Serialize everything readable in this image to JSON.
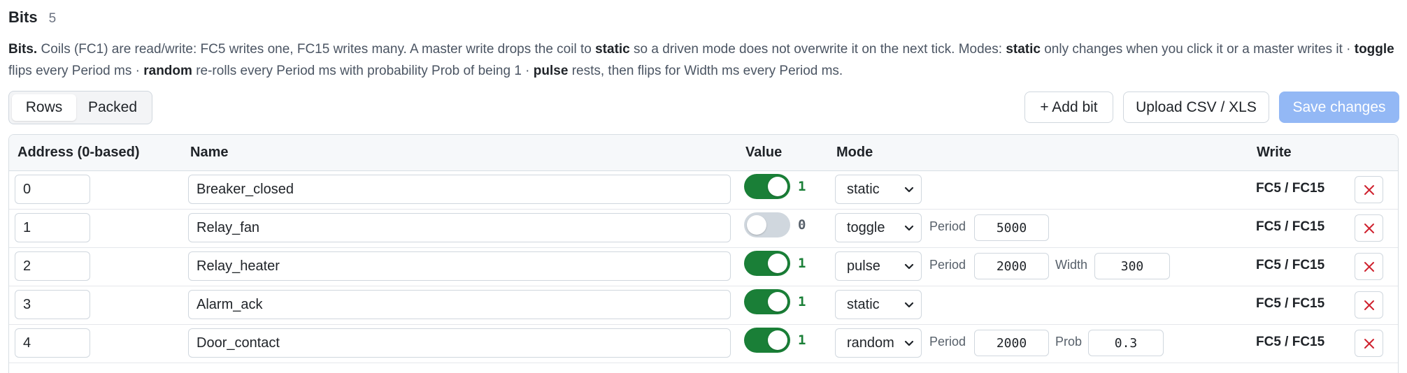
{
  "header": {
    "title": "Bits",
    "count": "5"
  },
  "description": {
    "p1": "Bits.",
    "p2": " Coils (FC1) are read/write: FC5 writes one, FC15 writes many. A master write drops the coil to ",
    "p3": "static",
    "p4": " so a driven mode does not overwrite it on the next tick. Modes: ",
    "p5": "static",
    "p6": " only changes when you click it or a master writes it · ",
    "p7": "toggle",
    "p8": " flips every Period ms · ",
    "p9": "random",
    "p10": " re-rolls every Period ms with probability Prob of being 1 · ",
    "p11": "pulse",
    "p12": " rests, then flips for Width ms every Period ms."
  },
  "view_toggle": {
    "rows_label": "Rows",
    "packed_label": "Packed",
    "selected": "Rows"
  },
  "toolbar": {
    "add_label": "+ Add bit",
    "upload_label": "Upload CSV / XLS",
    "save_label": "Save changes"
  },
  "columns": {
    "address": "Address (0-based)",
    "name": "Name",
    "value": "Value",
    "mode": "Mode",
    "write": "Write"
  },
  "rows": [
    {
      "address": "0",
      "name": "Breaker_closed",
      "on": true,
      "value": "1",
      "mode": "static",
      "write": "FC5 / FC15"
    },
    {
      "address": "1",
      "name": "Relay_fan",
      "on": false,
      "value": "0",
      "mode": "toggle",
      "p1_label": "Period",
      "p1_value": "5000",
      "write": "FC5 / FC15"
    },
    {
      "address": "2",
      "name": "Relay_heater",
      "on": true,
      "value": "1",
      "mode": "pulse",
      "p1_label": "Period",
      "p1_value": "2000",
      "p2_label": "Width",
      "p2_value": "300",
      "write": "FC5 / FC15"
    },
    {
      "address": "3",
      "name": "Alarm_ack",
      "on": true,
      "value": "1",
      "mode": "static",
      "write": "FC5 / FC15"
    },
    {
      "address": "4",
      "name": "Door_contact",
      "on": true,
      "value": "1",
      "mode": "random",
      "p1_label": "Period",
      "p1_value": "2000",
      "p2_label": "Prob",
      "p2_value": "0.3",
      "write": "FC5 / FC15"
    }
  ],
  "colors": {
    "toggle_on": "#1a7f37",
    "toggle_off": "#d0d7de",
    "primary_disabled": "#93b8f5",
    "delete_icon": "#cf222e"
  }
}
